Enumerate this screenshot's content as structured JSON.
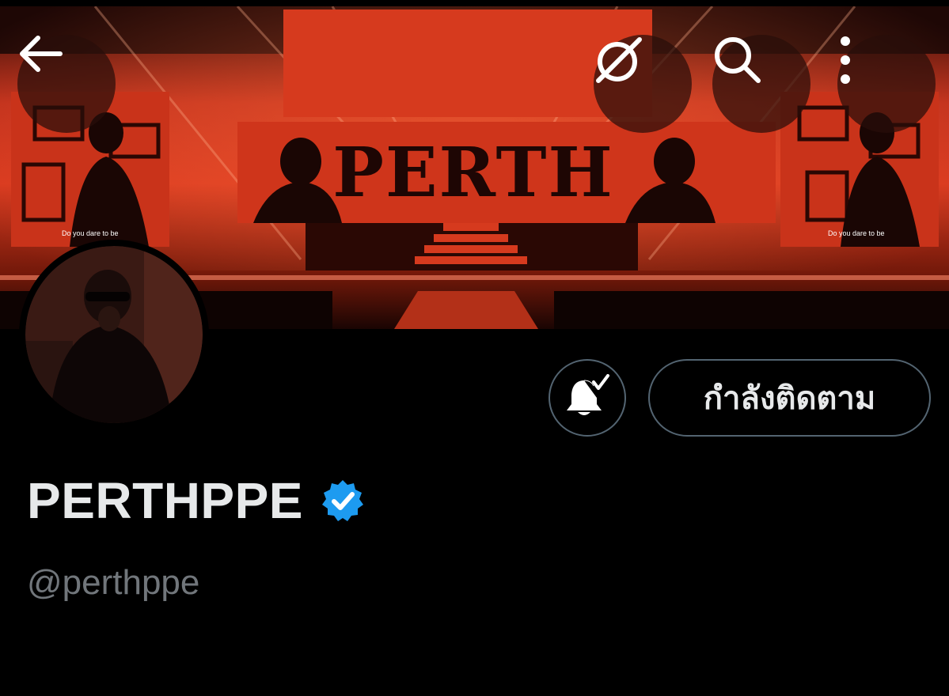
{
  "profile": {
    "display_name": "PERTHPPE",
    "handle": "@perthppe",
    "verified": true
  },
  "actions": {
    "follow_label": "กำลังติดตาม"
  },
  "banner": {
    "title": "PERTH",
    "screen_caption": "Do you dare to be"
  },
  "colors": {
    "background": "#000000",
    "text_primary": "#e7e9ea",
    "text_secondary": "#71767b",
    "button_border": "#536471",
    "verified_badge": "#1d9bf0",
    "banner_red": "#d8391f"
  },
  "icons": {
    "back": "arrow-left-icon",
    "grok": "grok-icon",
    "search": "search-icon",
    "more": "more-vertical-icon",
    "notifications": "bell-check-icon",
    "verified": "verified-badge-icon"
  }
}
